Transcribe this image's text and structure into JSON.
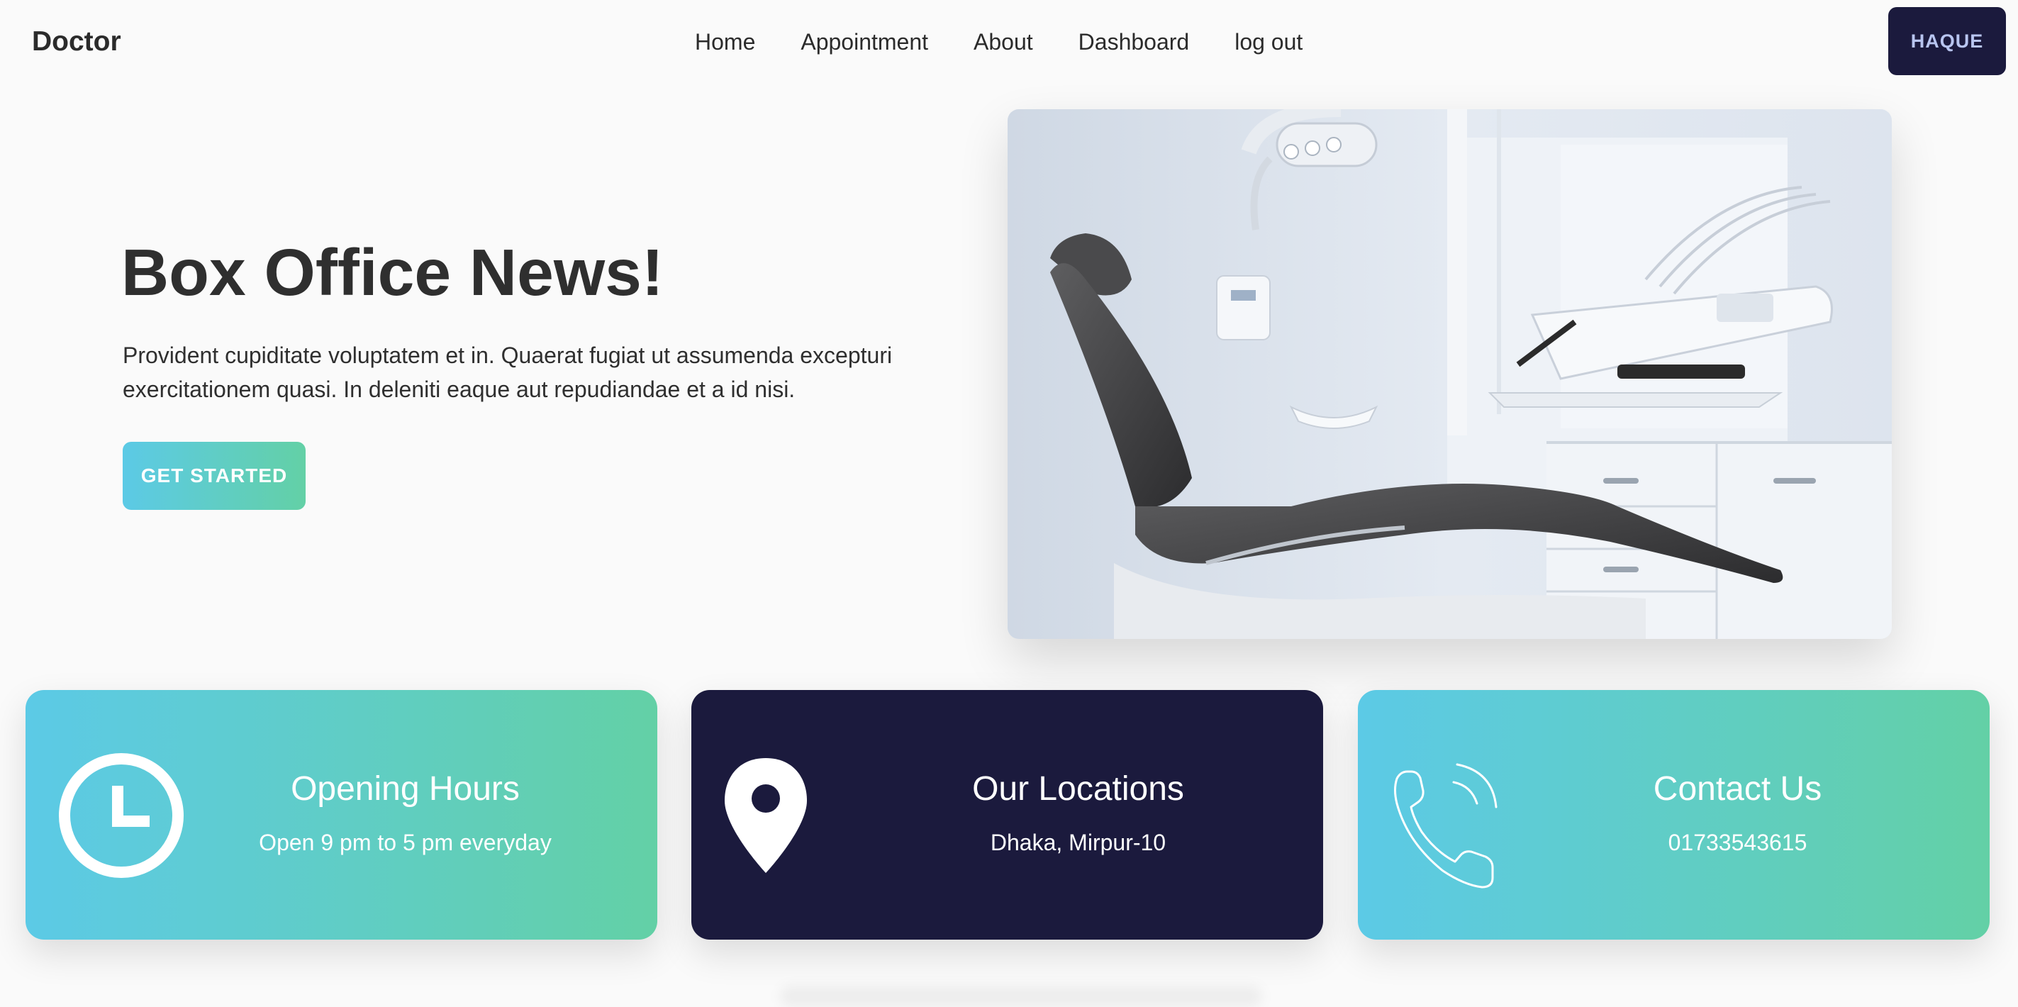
{
  "navbar": {
    "brand": "Doctor",
    "links": [
      "Home",
      "Appointment",
      "About",
      "Dashboard",
      "log out"
    ],
    "user_button": "HAQUE",
    "user_button_color": "#1b1a3d"
  },
  "hero": {
    "title": "Box Office News!",
    "text": "Provident cupiditate voluptatem et in. Quaerat fugiat ut assumenda excepturi exercitationem quasi. In deleniti eaque aut repudiandae et a id nisi.",
    "button_label": "GET STARTED",
    "image_icon": "dental-chair-image"
  },
  "cards": [
    {
      "title": "Opening Hours",
      "subtitle": "Open 9 pm to 5 pm everyday",
      "icon": "clock-icon",
      "style": "gradient"
    },
    {
      "title": "Our Locations",
      "subtitle": "Dhaka, Mirpur-10",
      "icon": "location-pin-icon",
      "style": "dark"
    },
    {
      "title": "Contact Us",
      "subtitle": "01733543615",
      "icon": "phone-icon",
      "style": "gradient"
    }
  ],
  "colors": {
    "gradient_start": "#5ccae6",
    "gradient_end": "#63d0a6",
    "dark": "#1b1a3d",
    "background": "#fafafa"
  }
}
